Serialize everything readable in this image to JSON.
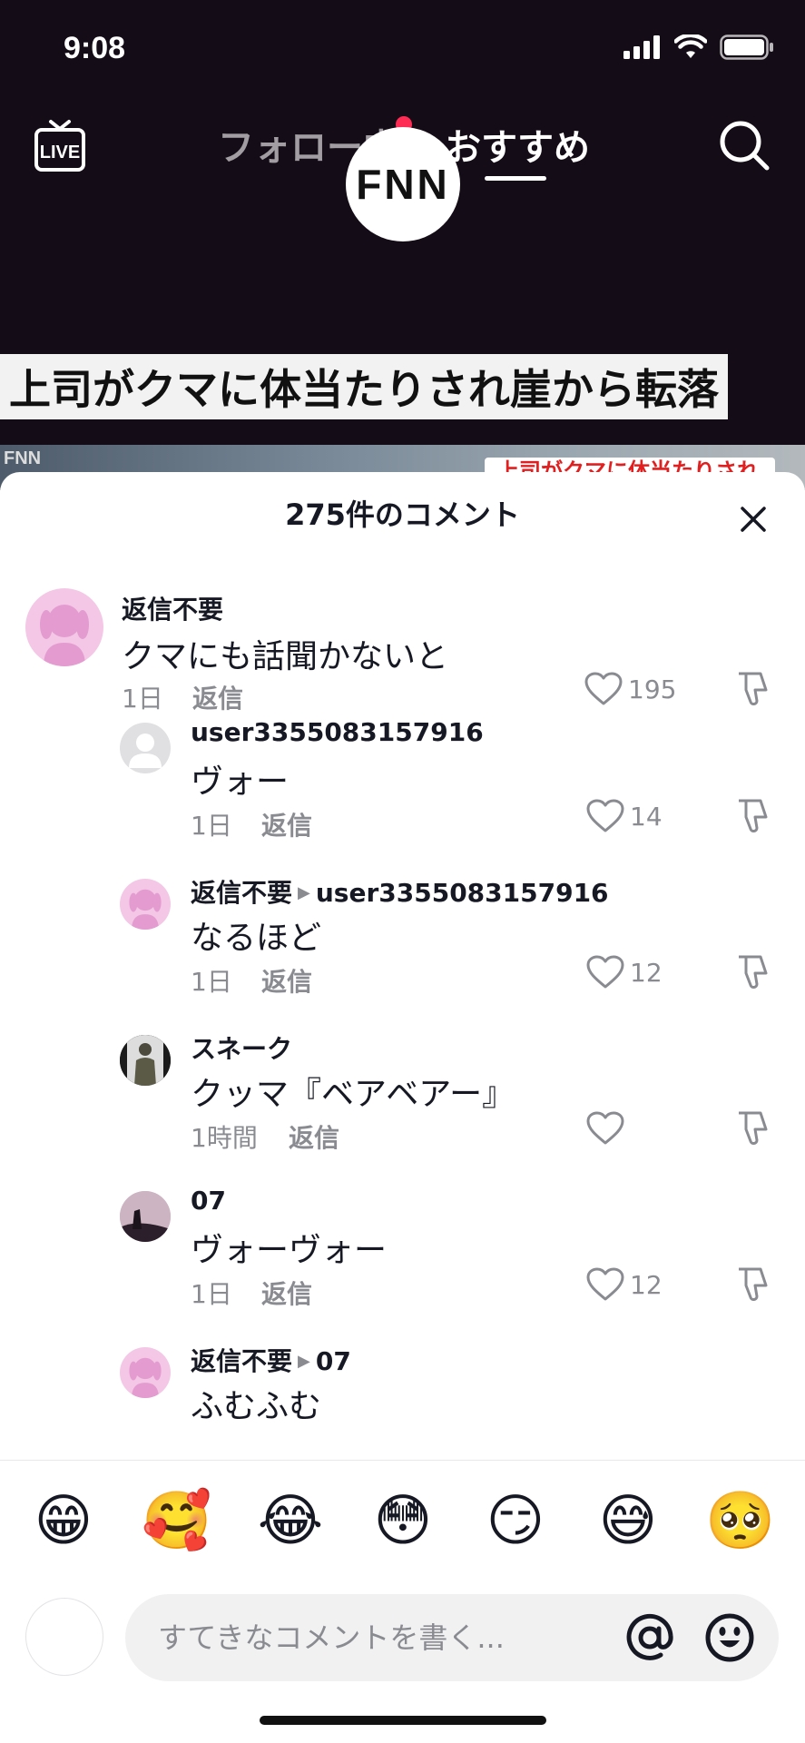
{
  "status_bar": {
    "time": "9:08"
  },
  "top_nav": {
    "live_label": "LIVE",
    "tab_following": "フォロー中",
    "tab_recommended": "おすすめ"
  },
  "video": {
    "channel_logo": "FNN",
    "headline": "上司がクマに体当たりされ崖から転落",
    "strip_logo": "FNN",
    "strip_text": "上司がクマに体当たりされ"
  },
  "comments_sheet": {
    "title": "275件のコメント",
    "comments": [
      {
        "user": "返信不要",
        "text": "クマにも話聞かないと",
        "time": "1日",
        "reply": "返信",
        "likes": "195"
      },
      {
        "user": "user3355083157916",
        "text": "ヴォー",
        "time": "1日",
        "reply": "返信",
        "likes": "14"
      },
      {
        "user": "返信不要",
        "reply_to": "user3355083157916",
        "text": "なるほど",
        "time": "1日",
        "reply": "返信",
        "likes": "12"
      },
      {
        "user": "スネーク",
        "text": "クッマ『ベアベアー』",
        "time": "1時間",
        "reply": "返信",
        "likes": ""
      },
      {
        "user": "07",
        "text": "ヴォーヴォー",
        "time": "1日",
        "reply": "返信",
        "likes": "12"
      },
      {
        "user": "返信不要",
        "reply_to": "07",
        "text": "ふむふむ"
      }
    ]
  },
  "emoji_bar": [
    "😁",
    "🥰",
    "😂",
    "😳",
    "😏",
    "😅",
    "🥺"
  ],
  "input": {
    "placeholder": "すてきなコメントを書く..."
  },
  "icons": [
    "live-icon",
    "search-icon",
    "close-icon",
    "heart-icon",
    "dislike-icon",
    "at-icon",
    "smiley-icon"
  ],
  "colors": {
    "accent": "#fe2c55",
    "header_bg": "#140c17",
    "muted_text": "#8a8b91"
  }
}
